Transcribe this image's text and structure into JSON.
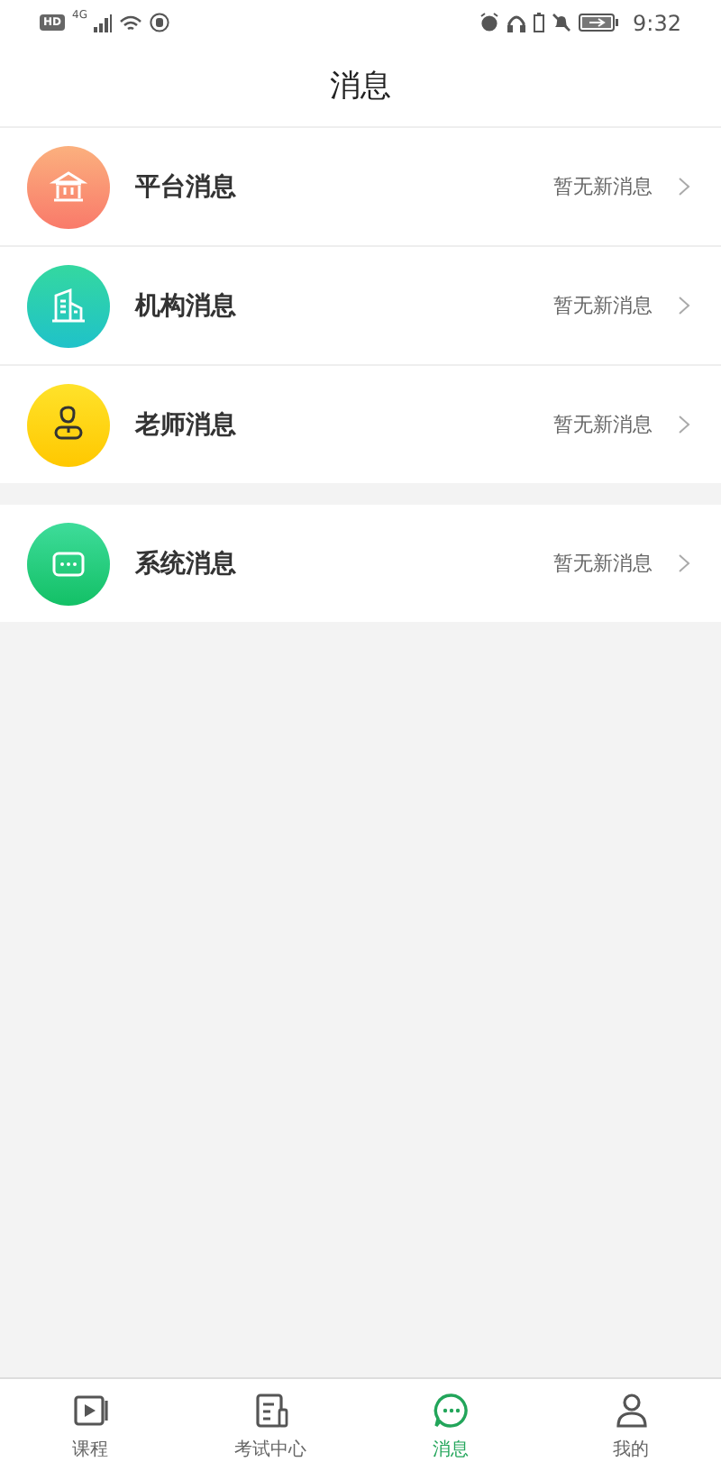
{
  "status_bar": {
    "hd_badge": "HD",
    "network": "4G",
    "time": "9:32"
  },
  "header": {
    "title": "消息"
  },
  "groups": [
    {
      "items": [
        {
          "kind": "bank",
          "label": "平台消息",
          "status": "暂无新消息"
        },
        {
          "kind": "building",
          "label": "机构消息",
          "status": "暂无新消息"
        },
        {
          "kind": "teacher",
          "label": "老师消息",
          "status": "暂无新消息"
        }
      ]
    },
    {
      "items": [
        {
          "kind": "chat",
          "label": "系统消息",
          "status": "暂无新消息"
        }
      ]
    }
  ],
  "tab_bar": [
    {
      "kind": "video",
      "label": "课程",
      "selected": false
    },
    {
      "kind": "exam",
      "label": "考试中心",
      "selected": false
    },
    {
      "kind": "chat",
      "label": "消息",
      "selected": true
    },
    {
      "kind": "person",
      "label": "我的",
      "selected": false
    }
  ]
}
